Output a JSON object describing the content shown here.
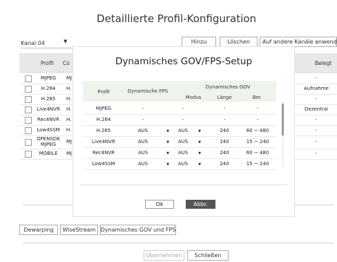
{
  "background": {
    "title": "Detaillierte Profil-Konfiguration",
    "kanal": "Kanal 04",
    "kanal_arrow": "▼",
    "buttons": {
      "hinzu": "Hinzu",
      "loeschen": "Löschen",
      "copy": "Auf andere Kanäle anwenden"
    },
    "headers": {
      "profil": "Profil",
      "co": "Co",
      "belegt": "Belegt"
    },
    "rows": [
      {
        "name": "MJPEG",
        "co": "MJ",
        "belegt": "-"
      },
      {
        "name": "H.264",
        "co": "H.",
        "belegt": "Aufnahme"
      },
      {
        "name": "H.265",
        "co": "H.",
        "belegt": "-"
      },
      {
        "name": "Live4NVR",
        "co": "H.",
        "belegt": "Dezentral"
      },
      {
        "name": "Rec4NVR",
        "co": "H.",
        "belegt": "-"
      },
      {
        "name": "Low4SSM",
        "co": "H.",
        "belegt": "-"
      },
      {
        "name": "OPENSDK MJPEG",
        "co": "MJ",
        "belegt": "-"
      },
      {
        "name": "MOBILE",
        "co": "MJ",
        "belegt": "-"
      }
    ],
    "bottom_buttons": {
      "dewarping": "Dewarping",
      "wisestream": "WiseStream",
      "gov_fps": "Dynamisches GOV und FPS"
    },
    "footer": {
      "apply": "Übernehmen",
      "close": "Schließen"
    }
  },
  "modal": {
    "title": "Dynamisches GOV/FPS-Setup",
    "headers": {
      "profil": "Profil",
      "fps": "Dynamische FPS",
      "gov": "Dynamisches GOV",
      "modus": "Modus",
      "laenge": "Länge",
      "ber": "Ber."
    },
    "rows": [
      {
        "profil": "MJPEG",
        "fps": "-",
        "fps_arrow": "",
        "modus": "-",
        "modus_arrow": "",
        "laenge": "-",
        "ber": "-"
      },
      {
        "profil": "H.264",
        "fps": "-",
        "fps_arrow": "",
        "modus": "-",
        "modus_arrow": "",
        "laenge": "-",
        "ber": "-"
      },
      {
        "profil": "H.265",
        "fps": "AUS",
        "fps_arrow": "▼",
        "modus": "AUS",
        "modus_arrow": "▼",
        "laenge": "240",
        "ber": "60 ~ 480"
      },
      {
        "profil": "Live4NVR",
        "fps": "AUS",
        "fps_arrow": "▼",
        "modus": "AUS",
        "modus_arrow": "▼",
        "laenge": "240",
        "ber": "15 ~ 240"
      },
      {
        "profil": "Rec4NVR",
        "fps": "AUS",
        "fps_arrow": "▼",
        "modus": "AUS",
        "modus_arrow": "▼",
        "laenge": "240",
        "ber": "60 ~ 480"
      },
      {
        "profil": "Low4SSM",
        "fps": "AUS",
        "fps_arrow": "▼",
        "modus": "AUS",
        "modus_arrow": "▼",
        "laenge": "240",
        "ber": "15 ~ 240"
      }
    ],
    "ok": "Ok",
    "cancel": "Abbr."
  },
  "colors": {
    "cancel_bg": "#555555",
    "table_head": "#eef3ec",
    "bg_head": "#e8e8e8"
  }
}
